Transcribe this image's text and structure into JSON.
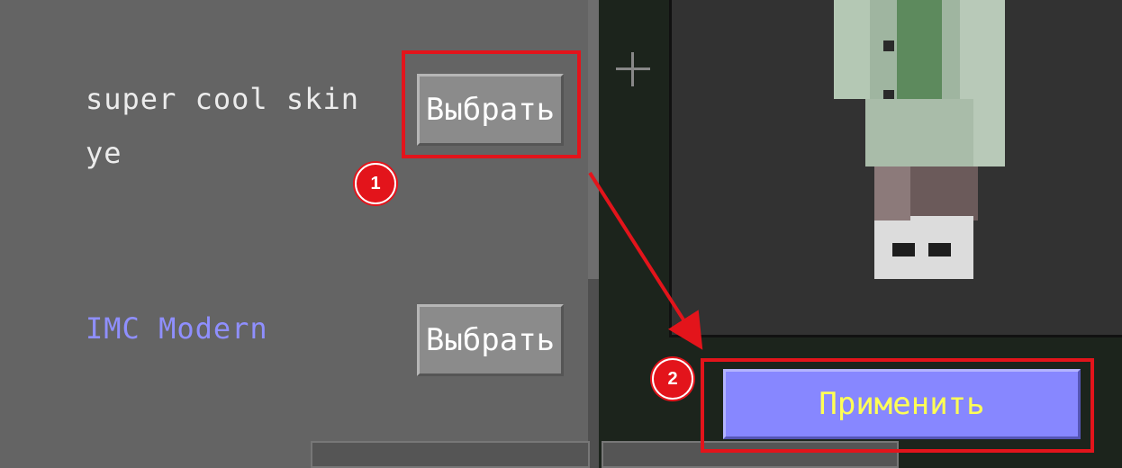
{
  "skins": [
    {
      "name_line1": "super cool skin",
      "name_line2": "ye",
      "select_label": "Выбрать"
    },
    {
      "name_line1": "IMC Modern",
      "select_label": "Выбрать"
    }
  ],
  "apply_label": "Применить",
  "annotations": {
    "badge1": "1",
    "badge2": "2"
  },
  "colors": {
    "highlight": "#e3141b",
    "apply_text": "#ffff55",
    "apply_bg": "#8787ff",
    "modern_name": "#8f8fff"
  }
}
